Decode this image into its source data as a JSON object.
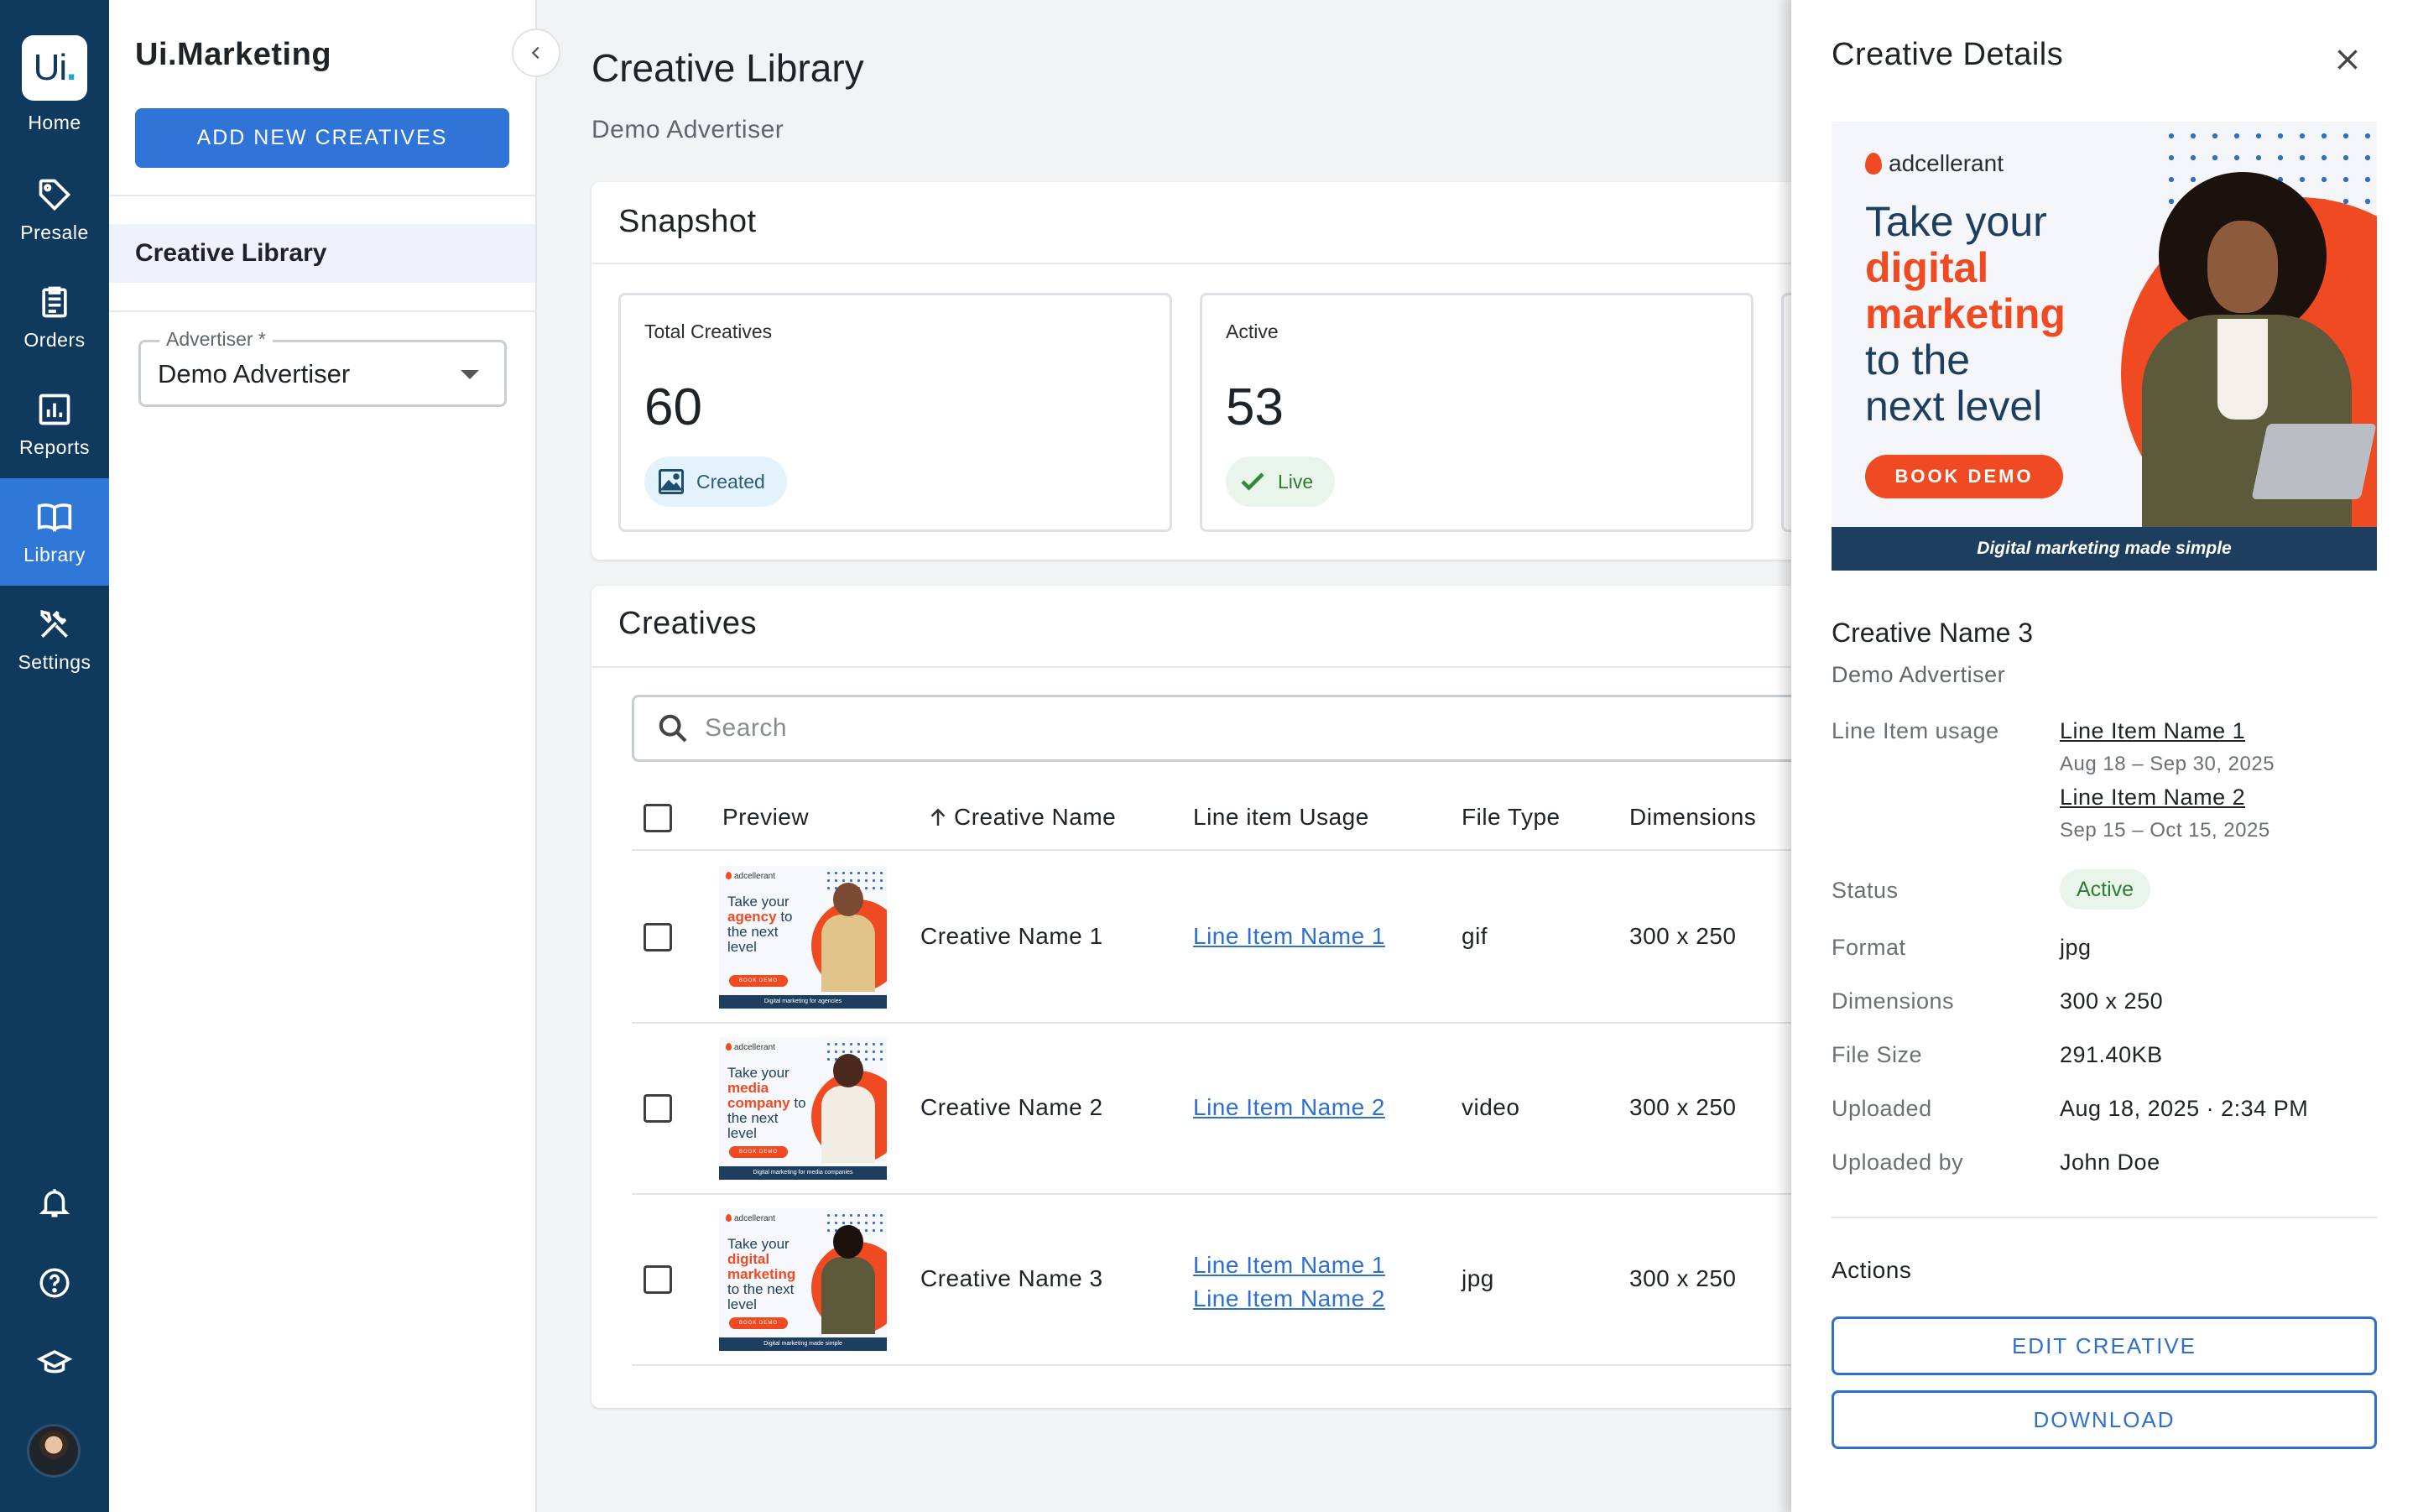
{
  "rail": {
    "logo_text": "Ui",
    "logo_dot": ".",
    "items": [
      {
        "label": "Home",
        "icon": "home-logo"
      },
      {
        "label": "Presale",
        "icon": "tag-icon"
      },
      {
        "label": "Orders",
        "icon": "clipboard-icon"
      },
      {
        "label": "Reports",
        "icon": "bar-chart-icon"
      },
      {
        "label": "Library",
        "icon": "book-icon",
        "active": true
      },
      {
        "label": "Settings",
        "icon": "tools-icon"
      }
    ],
    "bottom_icons": [
      "bell-icon",
      "help-icon",
      "graduation-cap-icon",
      "user-avatar"
    ]
  },
  "sidebar": {
    "app_title": "Ui.Marketing",
    "add_button": "ADD NEW CREATIVES",
    "nav_item": "Creative Library",
    "advertiser_label": "Advertiser *",
    "advertiser_value": "Demo Advertiser"
  },
  "page": {
    "title": "Creative Library",
    "subtitle": "Demo Advertiser"
  },
  "snapshot": {
    "title": "Snapshot",
    "stats": [
      {
        "label": "Total Creatives",
        "value": "60",
        "chip": "Created"
      },
      {
        "label": "Active",
        "value": "53",
        "chip": "Live"
      }
    ]
  },
  "creatives": {
    "title": "Creatives",
    "search_placeholder": "Search",
    "columns": [
      "Preview",
      "Creative Name",
      "Line item Usage",
      "File Type",
      "Dimensions"
    ],
    "sort_column": "Creative Name",
    "rows": [
      {
        "name": "Creative Name 1",
        "line_items": [
          "Line Item Name 1"
        ],
        "file_type": "gif",
        "dimensions": "300 x 250",
        "thumb": {
          "brand": "adcellerant",
          "pre": "Take your",
          "highlight": "agency",
          "post": "to the next level",
          "cta": "BOOK DEMO",
          "bar": "Digital marketing for agencies"
        }
      },
      {
        "name": "Creative Name 2",
        "line_items": [
          "Line Item Name 2"
        ],
        "file_type": "video",
        "dimensions": "300 x 250",
        "thumb": {
          "brand": "adcellerant",
          "pre": "Take your",
          "highlight": "media company",
          "post": "to the next level",
          "cta": "BOOK DEMO",
          "bar": "Digital marketing for media companies"
        }
      },
      {
        "name": "Creative Name 3",
        "line_items": [
          "Line Item Name 1",
          "Line Item Name 2"
        ],
        "file_type": "jpg",
        "dimensions": "300 x 250",
        "thumb": {
          "brand": "adcellerant",
          "pre": "Take your",
          "highlight": "digital marketing",
          "post": "to the next level",
          "cta": "BOOK DEMO",
          "bar": "Digital marketing made simple"
        }
      }
    ]
  },
  "drawer": {
    "title": "Creative Details",
    "preview": {
      "brand": "adcellerant",
      "pre": "Take your",
      "highlight_1": "digital",
      "highlight_2": "marketing",
      "post_1": "to the",
      "post_2": "next level",
      "cta": "BOOK DEMO",
      "bar": "Digital marketing made simple"
    },
    "creative_name": "Creative Name 3",
    "advertiser": "Demo Advertiser",
    "line_item_label": "Line Item usage",
    "line_items": [
      {
        "name": "Line Item Name 1",
        "dates": "Aug 18 – Sep 30, 2025"
      },
      {
        "name": "Line Item Name 2",
        "dates": "Sep 15 – Oct 15, 2025"
      }
    ],
    "status_label": "Status",
    "status_value": "Active",
    "format_label": "Format",
    "format_value": "jpg",
    "dimensions_label": "Dimensions",
    "dimensions_value": "300 x 250",
    "file_size_label": "File Size",
    "file_size_value": "291.40KB",
    "uploaded_label": "Uploaded",
    "uploaded_value": "Aug 18, 2025 · 2:34 PM",
    "uploaded_by_label": "Uploaded by",
    "uploaded_by_value": "John Doe",
    "actions_title": "Actions",
    "edit_button": "EDIT CREATIVE",
    "download_button": "DOWNLOAD"
  },
  "colors": {
    "rail_bg": "#0f3a5e",
    "accent": "#2f74d6",
    "brand_orange": "#f04a23",
    "success": "#2f7a36"
  }
}
